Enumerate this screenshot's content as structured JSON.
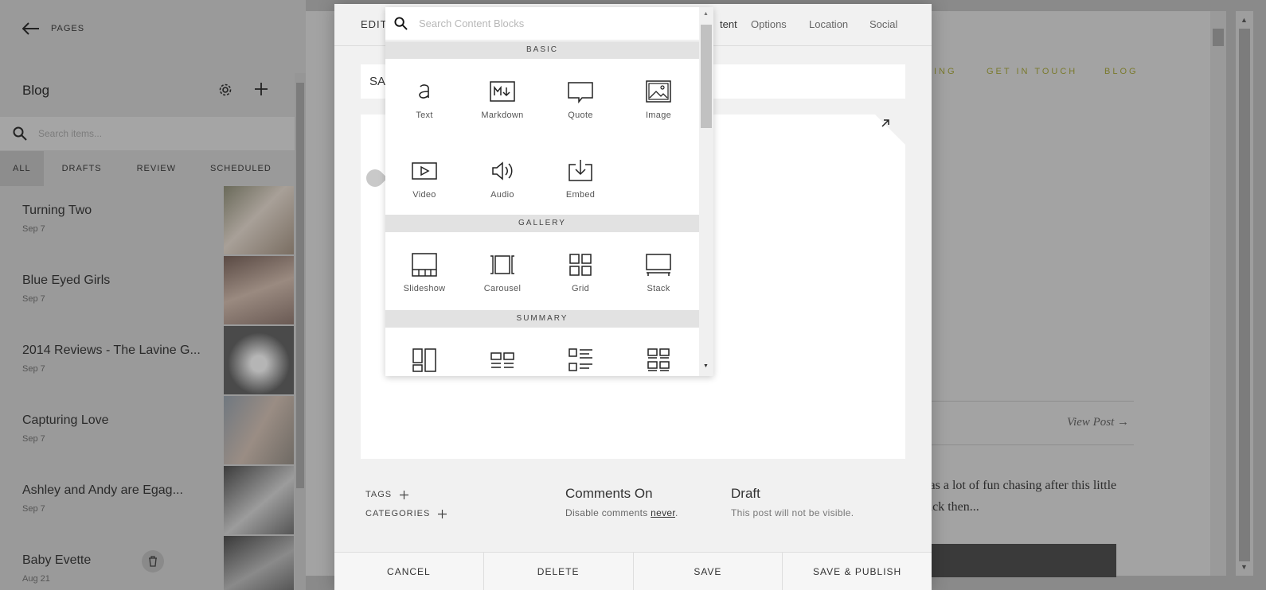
{
  "sidebar": {
    "back_label": "PAGES",
    "title": "Blog",
    "search_placeholder": "Search items...",
    "filters": [
      "ALL",
      "DRAFTS",
      "REVIEW",
      "SCHEDULED"
    ],
    "posts": [
      {
        "title": "Turning Two",
        "date": "Sep 7"
      },
      {
        "title": "Blue Eyed Girls",
        "date": "Sep 7"
      },
      {
        "title": "2014 Reviews - The Lavine G...",
        "date": "Sep 7"
      },
      {
        "title": "Capturing Love",
        "date": "Sep 7"
      },
      {
        "title": "Ashley and Andy are Egag...",
        "date": "Sep 7"
      },
      {
        "title": "Baby Evette",
        "date": "Aug 21"
      }
    ]
  },
  "preview": {
    "nav": [
      "ICING",
      "GET IN TOUCH",
      "BLOG"
    ],
    "view_post": "View Post →",
    "excerpt_line1": "was a lot of fun chasing after this little",
    "excerpt_line2": "back then..."
  },
  "editor": {
    "edit_label": "EDIT",
    "tabs": [
      "tent",
      "Options",
      "Location",
      "Social"
    ],
    "title_value": "SA",
    "tags_label": "TAGS",
    "categories_label": "CATEGORIES",
    "comments_heading": "Comments On",
    "comments_sub_prefix": "Disable comments",
    "comments_sub_link": "never",
    "comments_sub_suffix": ".",
    "draft_heading": "Draft",
    "draft_sub": "This post will not be visible.",
    "buttons": {
      "cancel": "CANCEL",
      "delete": "DELETE",
      "save": "SAVE",
      "save_publish": "SAVE & PUBLISH"
    }
  },
  "picker": {
    "search_placeholder": "Search Content Blocks",
    "sections": {
      "basic": "BASIC",
      "gallery": "GALLERY",
      "summary": "SUMMARY"
    },
    "basic": [
      {
        "label": "Text",
        "icon": "text-icon"
      },
      {
        "label": "Markdown",
        "icon": "markdown-icon"
      },
      {
        "label": "Quote",
        "icon": "quote-icon"
      },
      {
        "label": "Image",
        "icon": "image-icon"
      },
      {
        "label": "Video",
        "icon": "video-icon"
      },
      {
        "label": "Audio",
        "icon": "audio-icon"
      },
      {
        "label": "Embed",
        "icon": "embed-icon"
      }
    ],
    "gallery": [
      {
        "label": "Slideshow",
        "icon": "slideshow-icon"
      },
      {
        "label": "Carousel",
        "icon": "carousel-icon"
      },
      {
        "label": "Grid",
        "icon": "grid-icon"
      },
      {
        "label": "Stack",
        "icon": "stack-icon"
      }
    ]
  },
  "colors": {
    "accent_nav": "#7a7a2c",
    "overlay_gray": "#8a8a8a",
    "modal_bg": "#f1f1f1"
  }
}
